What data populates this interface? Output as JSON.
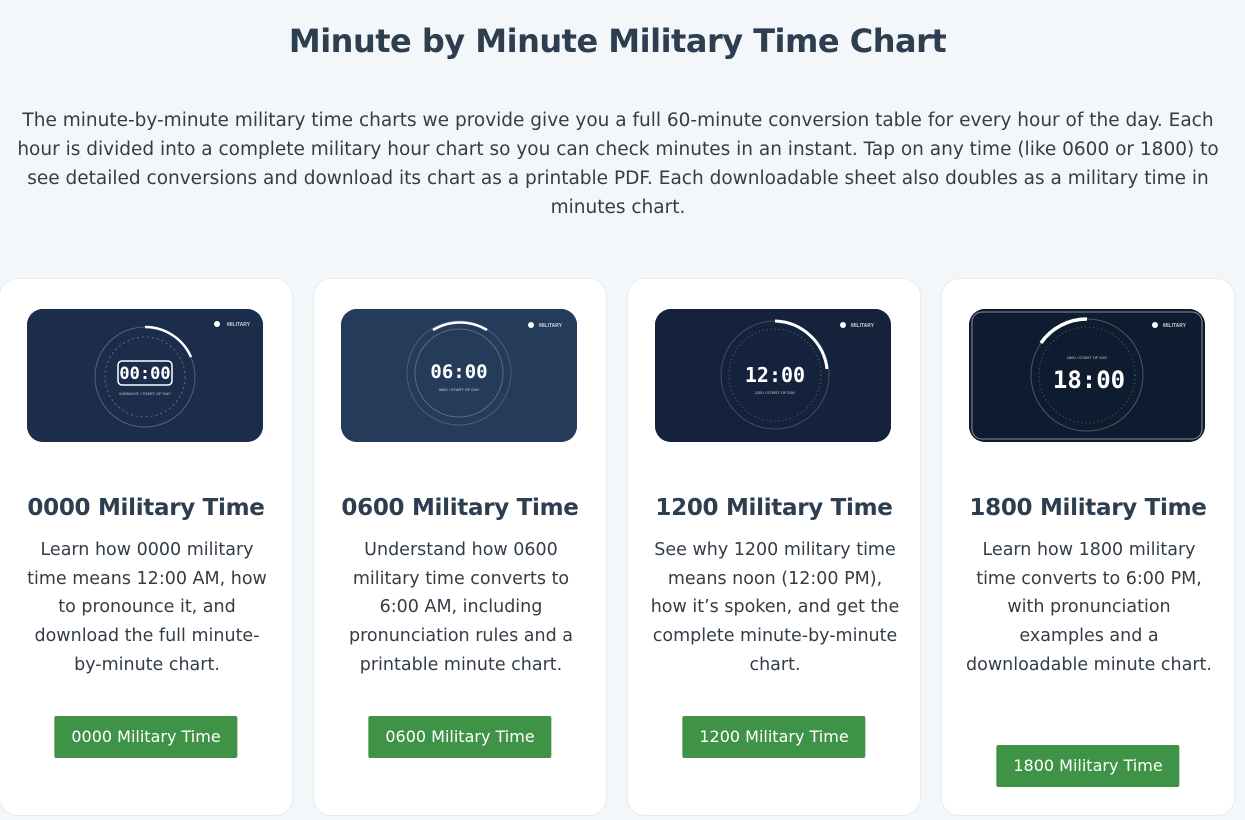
{
  "header": {
    "title": "Minute by Minute Military Time Chart",
    "intro": "The minute-by-minute military time charts we provide give you a full 60-minute conversion table for every hour of the day. Each hour is divided into a complete military hour chart so you can check minutes in an instant. Tap on any time (like 0600 or 1800) to see detailed conversions and download its chart as a printable PDF. Each downloadable sheet also doubles as a military time in minutes chart."
  },
  "cards": [
    {
      "clock": "00:00",
      "sub": "MIDNIGHT / START OF DAY",
      "brand": "MILITARY",
      "title": "0000 Military Time",
      "desc": "Learn how 0000 military time means 12:00 AM, how to pronounce it, and download the full minute-by-minute chart.",
      "button": "0000 Military Time"
    },
    {
      "clock": "06:00",
      "sub": "0600 / START OF DAY",
      "brand": "MILITARY",
      "title": "0600 Military Time",
      "desc": "Understand how 0600 military time converts to 6:00 AM, including pronunciation rules and a printable minute chart.",
      "button": "0600 Military Time"
    },
    {
      "clock": "12:00",
      "sub": "1200 / START OF DAY",
      "brand": "MILITARY",
      "title": "1200 Military Time",
      "desc": "See why 1200 military time means noon (12:00 PM), how it’s spoken, and get the complete minute-by-minute chart.",
      "button": "1200 Military Time"
    },
    {
      "clock": "18:00",
      "sub": "1800 / START OF DAY",
      "brand": "MILITARY",
      "title": "1800 Military Time",
      "desc": "Learn how 1800 military time converts to 6:00 PM, with pronunciation examples and a downloadable minute chart.",
      "button": "1800 Military Time"
    }
  ],
  "colors": {
    "button_bg": "#3f9347",
    "thumb_bg": "#1b2d4a",
    "title": "#2c3e50"
  }
}
